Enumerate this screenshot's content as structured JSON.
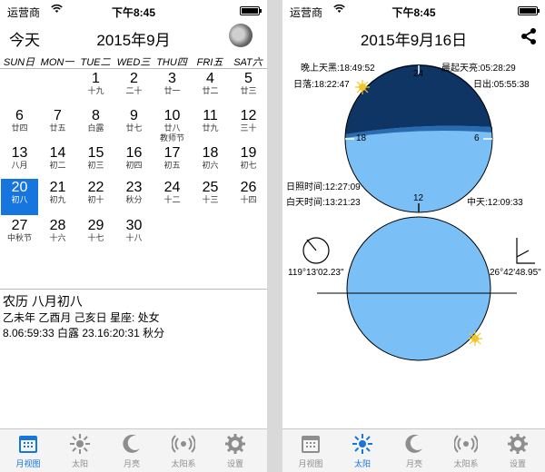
{
  "status": {
    "carrier": "运营商",
    "time": "下午8:45"
  },
  "calendar": {
    "today_label": "今天",
    "title": "2015年9月",
    "weekdays": [
      "SUN日",
      "MON一",
      "TUE二",
      "WED三",
      "THU四",
      "FRI五",
      "SAT六"
    ],
    "weeks": [
      [
        null,
        null,
        {
          "d": "1",
          "l": "十九"
        },
        {
          "d": "2",
          "l": "二十"
        },
        {
          "d": "3",
          "l": "廿一"
        },
        {
          "d": "4",
          "l": "廿二"
        },
        {
          "d": "5",
          "l": "廿三"
        }
      ],
      [
        {
          "d": "6",
          "l": "廿四"
        },
        {
          "d": "7",
          "l": "廿五"
        },
        {
          "d": "8",
          "l": "白露"
        },
        {
          "d": "9",
          "l": "廿七"
        },
        {
          "d": "10",
          "l": "廿八",
          "l2": "教师节"
        },
        {
          "d": "11",
          "l": "廿九"
        },
        {
          "d": "12",
          "l": "三十"
        }
      ],
      [
        {
          "d": "13",
          "l": "八月"
        },
        {
          "d": "14",
          "l": "初二"
        },
        {
          "d": "15",
          "l": "初三"
        },
        {
          "d": "16",
          "l": "初四"
        },
        {
          "d": "17",
          "l": "初五"
        },
        {
          "d": "18",
          "l": "初六"
        },
        {
          "d": "19",
          "l": "初七"
        }
      ],
      [
        {
          "d": "20",
          "l": "初八",
          "selected": true
        },
        {
          "d": "21",
          "l": "初九"
        },
        {
          "d": "22",
          "l": "初十"
        },
        {
          "d": "23",
          "l": "秋分"
        },
        {
          "d": "24",
          "l": "十二"
        },
        {
          "d": "25",
          "l": "十三"
        },
        {
          "d": "26",
          "l": "十四"
        }
      ],
      [
        {
          "d": "27",
          "l": "中秋节"
        },
        {
          "d": "28",
          "l": "十六"
        },
        {
          "d": "29",
          "l": "十七"
        },
        {
          "d": "30",
          "l": "十八"
        },
        null,
        null,
        null
      ]
    ],
    "info": {
      "lunar": "农历 八月初八",
      "ganzhi": "乙未年 乙酉月 己亥日 星座: 处女",
      "terms": "8.06:59:33 白露  23.16:20:31 秋分"
    }
  },
  "sun": {
    "title": "2015年9月16日",
    "dusk": "晚上天黑:18:49:52",
    "dawn": "晨起天亮:05:28:29",
    "sunset": "日落:18:22:47",
    "sunrise": "日出:05:55:38",
    "dial": [
      "24",
      "18",
      "6",
      "12"
    ],
    "sunshine": "日照时间:12:27:09",
    "daytime": "白天时间:13:21:23",
    "noon": "中天:12:09:33",
    "longitude": "119°13'02.23\"",
    "latitude": "26°42'48.95\""
  },
  "tabs": [
    "月视图",
    "太阳",
    "月亮",
    "太阳系",
    "设置"
  ],
  "colors": {
    "accent": "#1775e0",
    "night": "#0f3565",
    "day": "#7ac0f7"
  }
}
